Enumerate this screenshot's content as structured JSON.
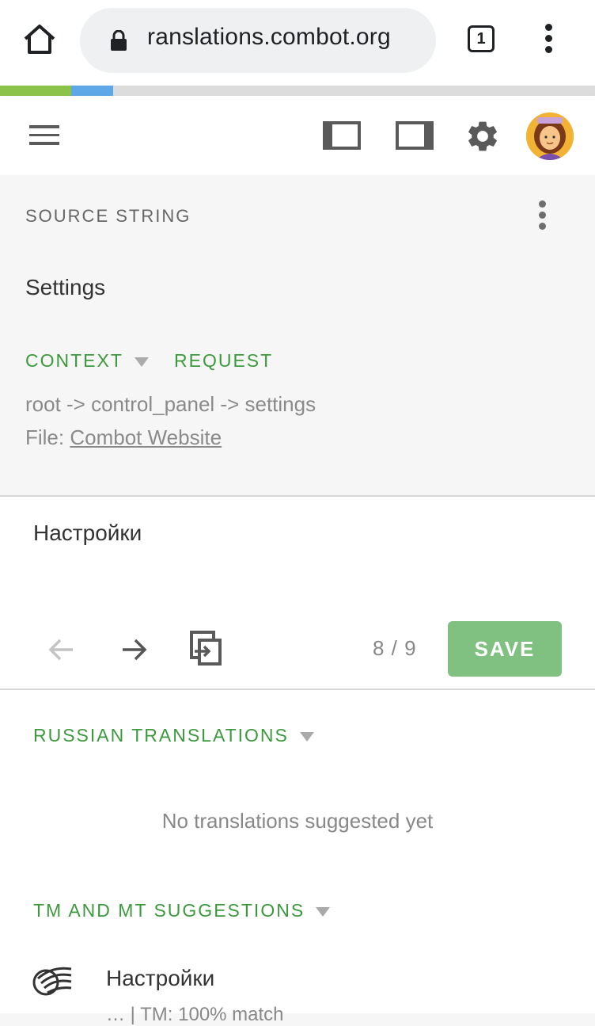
{
  "browser": {
    "url": "ranslations.combot.org",
    "tab_count": "1"
  },
  "progress": {
    "approved": 0.12,
    "translated": 0.07
  },
  "colors": {
    "accent_green": "#3c9a3c",
    "save_green": "#80c080"
  },
  "source": {
    "section_title": "SOURCE STRING",
    "text": "Settings",
    "context_label": "CONTEXT",
    "request_label": "REQUEST",
    "context_path": "root -> control_panel -> settings",
    "file_prefix": "File: ",
    "file_link": "Combot Website"
  },
  "editor": {
    "translation": "Настройки",
    "counter": "8 / 9",
    "save_label": "SAVE"
  },
  "translations": {
    "title": "RUSSIAN TRANSLATIONS",
    "empty": "No translations suggested yet"
  },
  "suggestions": {
    "title": "TM AND MT SUGGESTIONS",
    "items": [
      {
        "text": "Настройки",
        "meta": "… | TM: 100% match"
      }
    ]
  },
  "icons": [
    "home-icon",
    "lock-icon",
    "tabs-icon",
    "more-vert-icon",
    "menu-icon",
    "sidebar-left-icon",
    "sidebar-right-icon",
    "gear-icon",
    "avatar",
    "arrow-left-icon",
    "arrow-right-icon",
    "copy-source-icon",
    "crowdin-logo"
  ]
}
